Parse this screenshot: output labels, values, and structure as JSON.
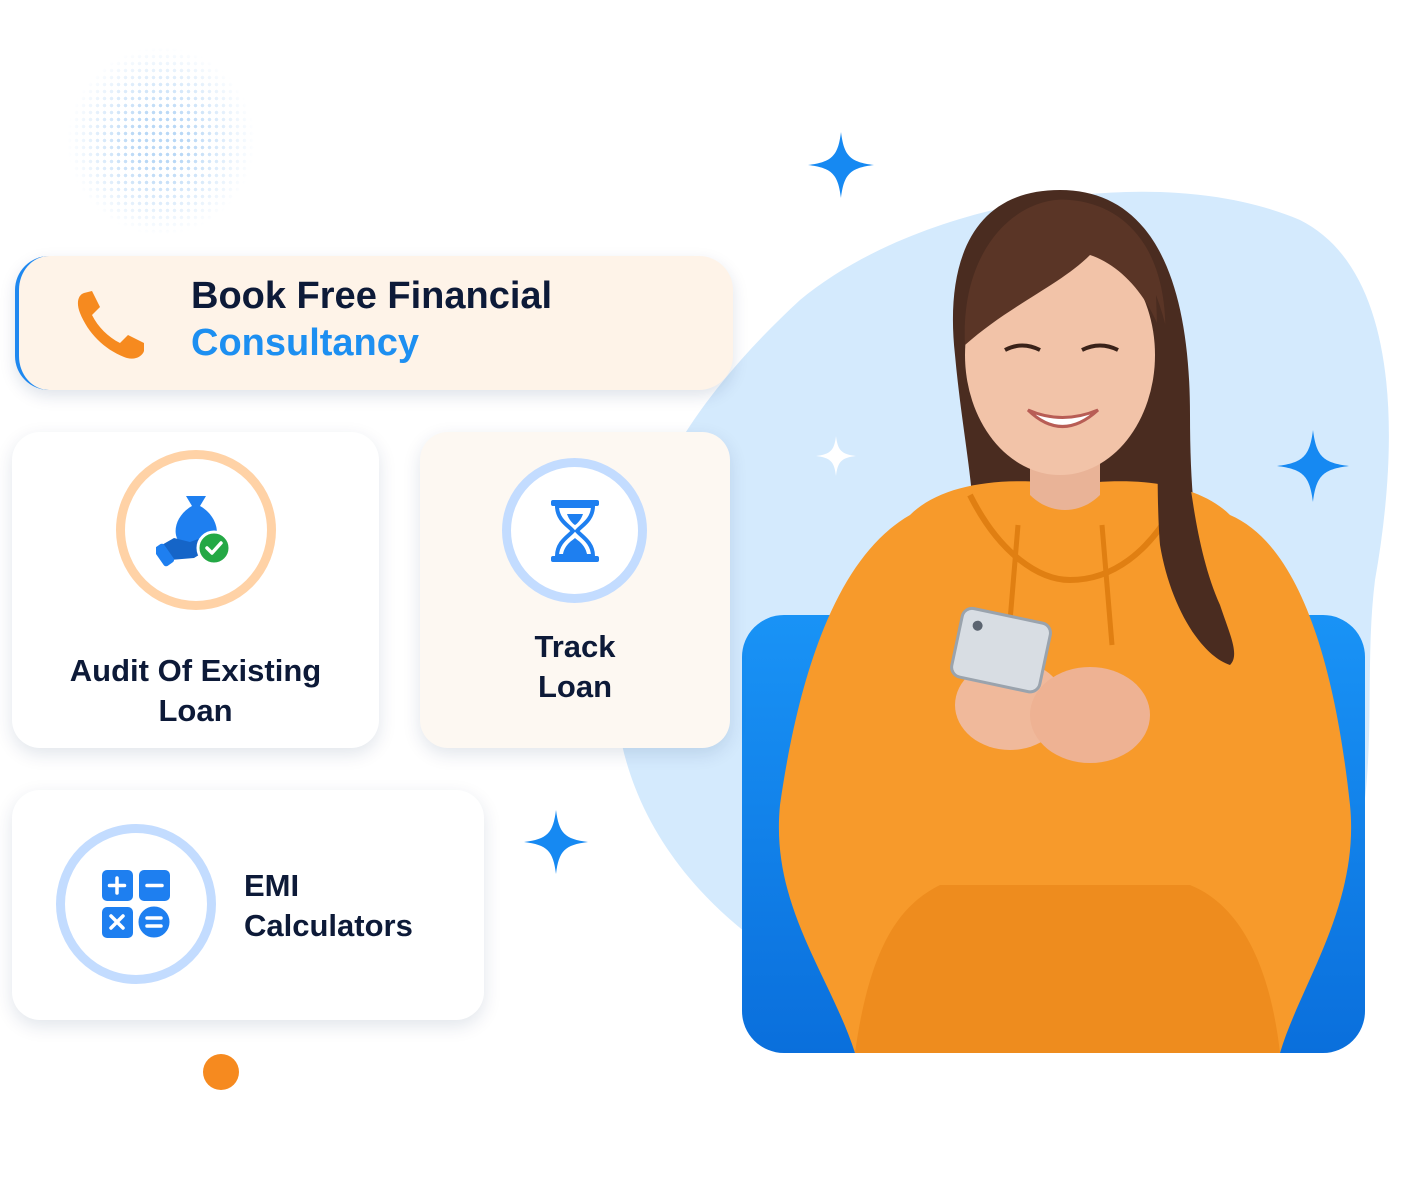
{
  "cta": {
    "line1": "Book Free Financial",
    "line2": "Consultancy",
    "icon": "phone-icon"
  },
  "cards": {
    "audit": {
      "line1": "Audit Of Existing",
      "line2": "Loan",
      "icon": "money-bag-check-icon"
    },
    "track": {
      "line1": "Track",
      "line2": "Loan",
      "icon": "hourglass-icon"
    },
    "emi": {
      "line1": "EMI",
      "line2": "Calculators",
      "icon": "calculator-icon"
    }
  },
  "colors": {
    "accent_blue": "#1d8ff1",
    "accent_orange": "#f68a1f",
    "heading_navy": "#0d1a38",
    "cta_background": "#fef3e8",
    "blob_light_blue": "#d4eafd"
  }
}
